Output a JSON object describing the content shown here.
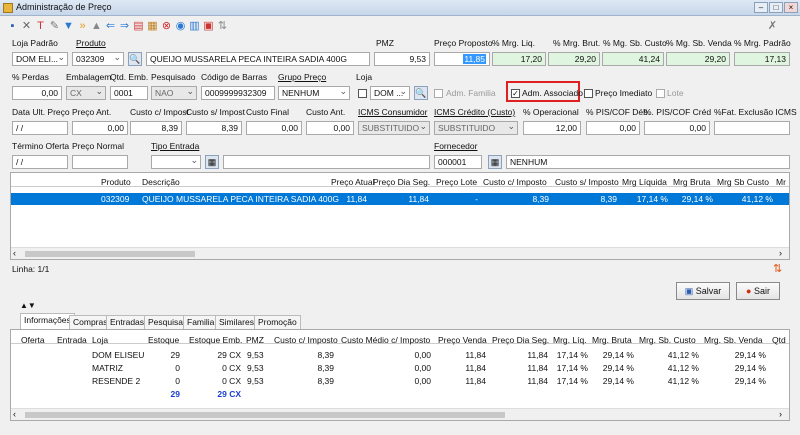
{
  "window": {
    "title": "Administração de Preço",
    "minimize": "–",
    "maximize": "□",
    "close": "×"
  },
  "row1": {
    "labels": {
      "loja_padrao": "Loja Padrão",
      "produto": "Produto",
      "pmz": "PMZ",
      "preco_proposto": "Preço Proposto",
      "mrg_liq": "% Mrg. Liq.",
      "mrg_brut": "% Mrg. Brut.",
      "mg_sb_custo": "% Mg. Sb. Custo",
      "mg_sb_venda": "% Mg. Sb. Venda",
      "mrg_padrao": "% Mrg. Padrão"
    },
    "values": {
      "loja_padrao": "DOM ELI...",
      "produto_codigo": "032309",
      "produto_descricao": "QUEIJO MUSSARELA PECA INTEIRA SADIA 400G",
      "pmz": "9,53",
      "preco_proposto": "11,85",
      "mrg_liq": "17,20",
      "mrg_brut": "29,20",
      "mg_sb_custo": "41,24",
      "mg_sb_venda": "29,20",
      "mrg_padrao": "17,13"
    }
  },
  "row2": {
    "labels": {
      "perdas": "% Perdas",
      "embalagem": "Embalagem",
      "qtd_emb": "Qtd. Emb.",
      "pesquisado": "Pesquisado",
      "codigo_barras": "Código de Barras",
      "grupo_preco": "Grupo Preço",
      "loja": "Loja",
      "adm_familia": "Adm. Familia",
      "adm_associado": "Adm. Associado",
      "preco_imediato": "Preço Imediato",
      "lote": "Lote"
    },
    "values": {
      "perdas": "0,00",
      "embalagem": "CX",
      "qtd_emb": "0001",
      "pesquisado": "NAO",
      "codigo_barras": "0009999932309",
      "grupo_preco": "NENHUM",
      "loja": "DOM ..."
    }
  },
  "row3": {
    "labels": {
      "data_ult_preco": "Data Ult. Preço",
      "preco_ant": "Preço Ant.",
      "custo_c_imposto": "Custo c/ Impost",
      "custo_s_imposto": "Custo s/ Impost",
      "custo_final": "Custo Final",
      "custo_ant": "Custo Ant.",
      "icms_consumidor": "ICMS Consumidor",
      "icms_credito": "ICMS Crédito (Custo)",
      "operacional": "% Operacional",
      "pis_cof_deb": "% PIS/COF Déb.",
      "pis_cof_cred": "%. PIS/COF Créd",
      "fat_exclusao": "%Fat. Exclusão ICMS"
    },
    "values": {
      "data_ult_preco": "/ /",
      "preco_ant": "0,00",
      "custo_c_imposto": "8,39",
      "custo_s_imposto": "8,39",
      "custo_final": "0,00",
      "custo_ant": "0,00",
      "icms_consumidor": "SUBSTITUIDO",
      "icms_credito": "SUBSTITUIDO",
      "operacional": "12,00",
      "pis_cof_deb": "0,00",
      "pis_cof_cred": "0,00",
      "fat_exclusao": ""
    }
  },
  "row4": {
    "labels": {
      "termino_oferta": "Término Oferta",
      "preco_normal": "Preço Normal",
      "tipo_entrada": "Tipo Entrada",
      "fornecedor": "Fornecedor"
    },
    "values": {
      "termino_oferta": "/ /",
      "preco_normal": "",
      "tipo_entrada": "",
      "fornecedor_codigo": "000001",
      "fornecedor_nome": "NENHUM"
    }
  },
  "main_grid": {
    "headers": [
      "Produto",
      "Descrição",
      "Preço Atual",
      "Preço Dia Seg.",
      "Preço Lote",
      "Custo c/ Imposto",
      "Custo s/ Imposto",
      "Mrg Líquida",
      "Mrg Bruta",
      "Mrg Sb Custo",
      "Mr"
    ],
    "row": {
      "produto": "032309",
      "descricao": "QUEIJO MUSSARELA PECA INTEIRA SADIA 400G",
      "preco_atual": "11,84",
      "preco_dia_seg": "11,84",
      "preco_lote": "-",
      "custo_c_imposto": "8,39",
      "custo_s_imposto": "8,39",
      "mrg_liquida": "17,14 %",
      "mrg_bruta": "29,14 %",
      "mrg_sb_custo": "41,12 %"
    }
  },
  "status": {
    "linha": "Linha: 1/1"
  },
  "buttons": {
    "salvar": "Salvar",
    "sair": "Sair"
  },
  "tabs": [
    "Informações",
    "Compras",
    "Entradas",
    "Pesquisa",
    "Familia",
    "Similares",
    "Promoção"
  ],
  "info_grid": {
    "headers": [
      "Oferta",
      "Entrada",
      "Loja",
      "Estoque",
      "Estoque Emb.",
      "PMZ",
      "Custo c/ Imposto",
      "Custo Médio c/ Imposto",
      "Preço Venda",
      "Preço Dia Seg.",
      "Mrg. Líq.",
      "Mrg. Bruta",
      "Mrg. Sb. Custo",
      "Mrg. Sb. Venda",
      "Qtd"
    ],
    "rows": [
      {
        "loja": "DOM ELISEU",
        "estoque": "29",
        "estoque_emb": "29 CX",
        "pmz": "9,53",
        "custo": "8,39",
        "custo_medio": "0,00",
        "preco_venda": "11,84",
        "preco_dia": "11,84",
        "mrg_liq": "17,14 %",
        "mrg_bruta": "29,14 %",
        "mrg_sb_custo": "41,12 %",
        "mrg_sb_venda": "29,14 %"
      },
      {
        "loja": "MATRIZ",
        "estoque": "0",
        "estoque_emb": "0 CX",
        "pmz": "9,53",
        "custo": "8,39",
        "custo_medio": "0,00",
        "preco_venda": "11,84",
        "preco_dia": "11,84",
        "mrg_liq": "17,14 %",
        "mrg_bruta": "29,14 %",
        "mrg_sb_custo": "41,12 %",
        "mrg_sb_venda": "29,14 %"
      },
      {
        "loja": "RESENDE 2",
        "estoque": "0",
        "estoque_emb": "0 CX",
        "pmz": "9,53",
        "custo": "8,39",
        "custo_medio": "0,00",
        "preco_venda": "11,84",
        "preco_dia": "11,84",
        "mrg_liq": "17,14 %",
        "mrg_bruta": "29,14 %",
        "mrg_sb_custo": "41,12 %",
        "mrg_sb_venda": "29,14 %"
      }
    ],
    "totals": {
      "estoque": "29",
      "estoque_emb": "29 CX"
    }
  }
}
